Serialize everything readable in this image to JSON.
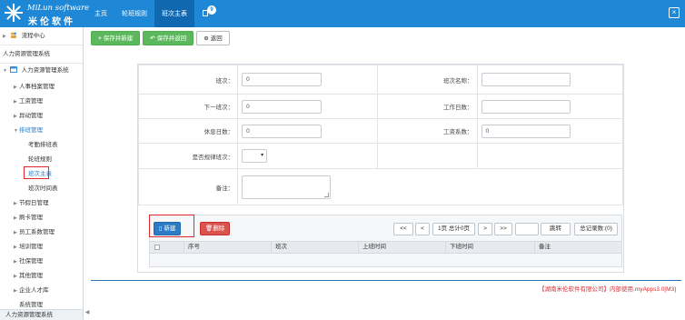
{
  "brand": {
    "line1": "MiLun software",
    "line2": "米伦软件"
  },
  "nav": {
    "items": [
      "主页",
      "轮班规则",
      "班次主表"
    ],
    "badge": "9"
  },
  "sidebar": {
    "process_center": "流程中心",
    "system_title": "人力资源管理系统",
    "group": "人力资源管理系统",
    "items": [
      "人事档案管理",
      "工资管理",
      "异动管理",
      "排班管理"
    ],
    "sub_items": [
      "考勤排班表",
      "轮班规则",
      "班次主表",
      "班次时间表"
    ],
    "more_items": [
      "节假日管理",
      "刷卡管理",
      "员工系数管理",
      "培训管理",
      "社保管理",
      "其他管理",
      "企业人才库",
      "系统管理"
    ],
    "bottom": "人力资源管理系统"
  },
  "toolbar": {
    "save_new": "保存并新建",
    "save_back": "保存并返回",
    "back": "返回"
  },
  "form": {
    "shift_label": "班次：",
    "shift_value": "0",
    "shift_name_label": "班次名称：",
    "shift_name_value": "",
    "next_shift_label": "下一班次：",
    "next_shift_value": "0",
    "work_days_label": "工作日数：",
    "work_days_value": "",
    "rest_days_label": "休息日数：",
    "rest_days_value": "0",
    "wage_factor_label": "工资系数：",
    "wage_factor_value": "0",
    "regular_label": "是否规律班次：",
    "remark_label": "备注："
  },
  "grid": {
    "new_label": "新建",
    "delete_label": "删除",
    "pager": {
      "first": "<<",
      "prev": "<",
      "info": "1页 总计0页",
      "next": ">",
      "last": ">>",
      "goto": "跳转",
      "total": "总记录数:(0)"
    },
    "columns": [
      "序号",
      "班次",
      "上班时间",
      "下班时间",
      "备注"
    ]
  },
  "footer": "【湖南米伦软件有限公司】内部使用.myApps3.0[M3]",
  "colors": {
    "topbar": "#1e88d6",
    "green": "#5cb85c",
    "blue": "#2b7cc4",
    "red": "#d9534f",
    "highlight": "#e0292e"
  }
}
